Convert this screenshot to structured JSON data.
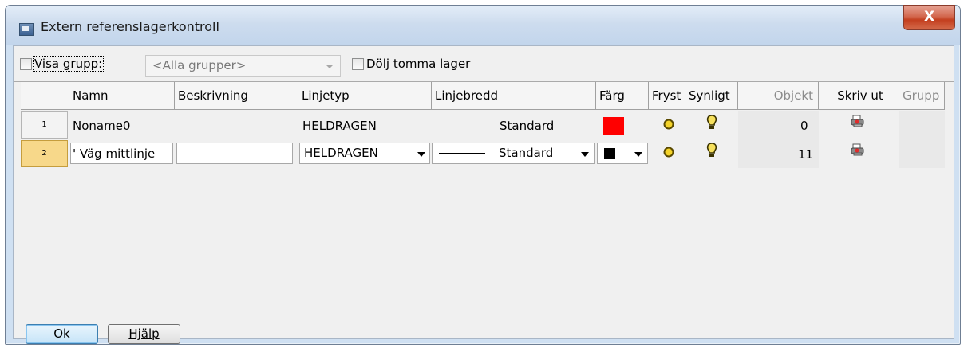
{
  "window": {
    "title": "Extern referenslagerkontroll",
    "close_glyph": "X"
  },
  "toolbar": {
    "show_group_label": "Visa grupp:",
    "group_combo_value": "<Alla grupper>",
    "hide_empty_label": "Dölj tomma lager"
  },
  "table": {
    "columns": [
      "Namn",
      "Beskrivning",
      "Linjetyp",
      "Linjebredd",
      "Färg",
      "Fryst",
      "Synligt",
      "Objekt",
      "Skriv ut",
      "Grupp"
    ],
    "rows": [
      {
        "num": "1",
        "name": "Noname0",
        "description": "",
        "linetype": "HELDRAGEN",
        "linewidth": "Standard",
        "color": "#ff0000",
        "objects": "0"
      },
      {
        "num": "2",
        "name": "' Väg mittlinje",
        "description": "",
        "linetype": "HELDRAGEN",
        "linewidth": "Standard",
        "color": "#000000",
        "objects": "11"
      }
    ]
  },
  "buttons": {
    "ok": "Ok",
    "help": "Hjälp"
  },
  "icons": [
    "app-icon",
    "close-icon",
    "freeze-sun-icon",
    "lightbulb-icon",
    "printer-icon",
    "chevron-down-icon"
  ]
}
